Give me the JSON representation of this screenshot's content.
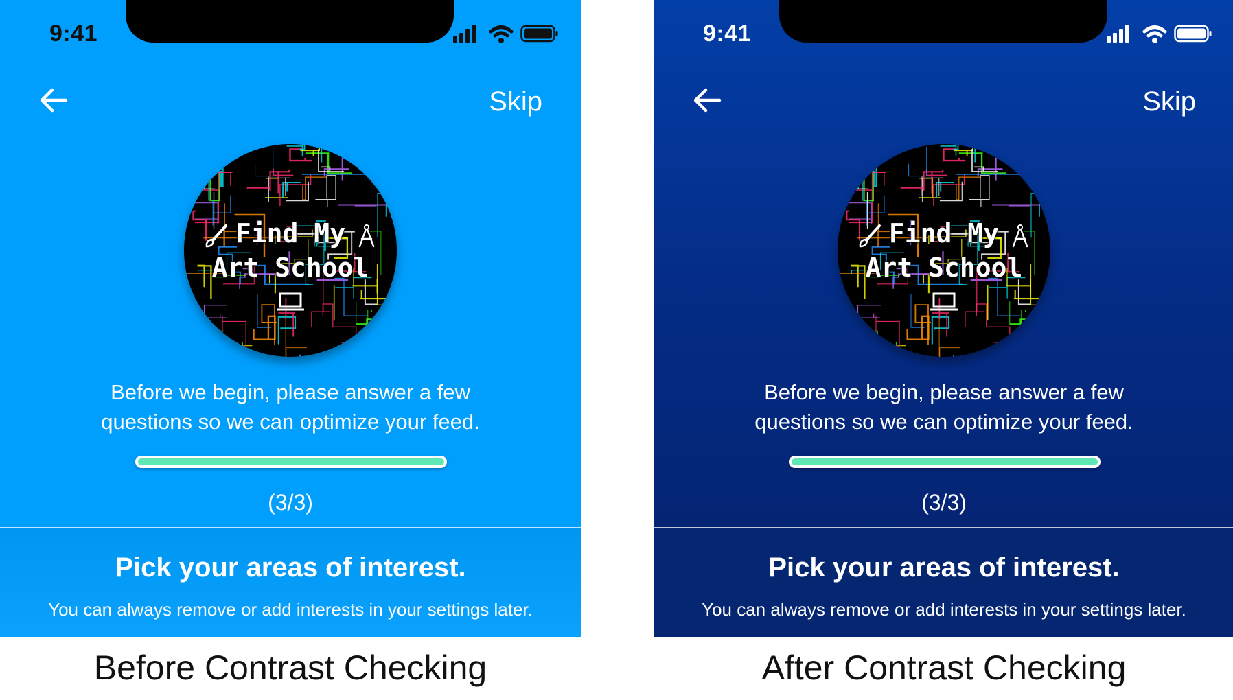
{
  "colors": {
    "before_background": "#009ffd",
    "after_background": "#042c86",
    "progress_fill": "#5fe8b4",
    "text": "#ffffff"
  },
  "screens": [
    {
      "id": "before",
      "status_time": "9:41",
      "back_icon": "arrow-left-icon",
      "skip_label": "Skip",
      "logo": {
        "line1": "Find My",
        "line2": "Art School",
        "icons": [
          "paintbrush-icon",
          "compass-icon",
          "laptop-icon"
        ]
      },
      "intro_line1": "Before we begin, please answer a few",
      "intro_line2": "questions so we can optimize your feed.",
      "progress": 1.0,
      "step_label": "(3/3)",
      "bottom_title": "Pick your areas of interest.",
      "bottom_subtitle": "You can always remove or add interests in your settings later."
    },
    {
      "id": "after",
      "status_time": "9:41",
      "back_icon": "arrow-left-icon",
      "skip_label": "Skip",
      "logo": {
        "line1": "Find My",
        "line2": "Art School",
        "icons": [
          "paintbrush-icon",
          "compass-icon",
          "laptop-icon"
        ]
      },
      "intro_line1": "Before we begin, please answer a few",
      "intro_line2": "questions so we can optimize your feed.",
      "progress": 1.0,
      "step_label": "(3/3)",
      "bottom_title": "Pick your areas of interest.",
      "bottom_subtitle": "You can always remove or add interests in your settings later."
    }
  ],
  "captions": [
    "Before Contrast Checking",
    "After Contrast Checking"
  ]
}
